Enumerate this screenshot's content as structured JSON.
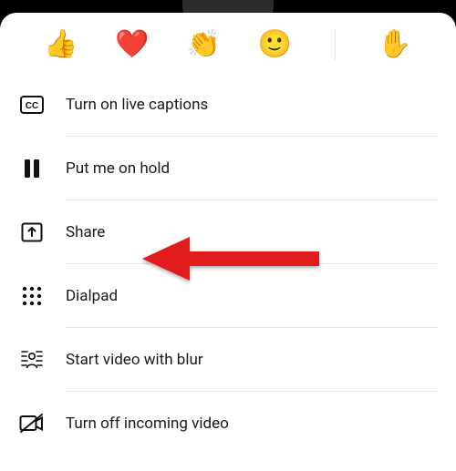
{
  "reactions": {
    "like": "👍",
    "heart": "❤️",
    "applause": "👏",
    "laugh": "🙂",
    "raise_hand": "✋"
  },
  "menu": {
    "captions": {
      "label": "Turn on live captions"
    },
    "hold": {
      "label": "Put me on hold"
    },
    "share": {
      "label": "Share"
    },
    "dialpad": {
      "label": "Dialpad"
    },
    "blur": {
      "label": "Start video with blur"
    },
    "incoming_off": {
      "label": "Turn off incoming video"
    }
  },
  "colors": {
    "annotation_arrow": "#e21b1b"
  }
}
